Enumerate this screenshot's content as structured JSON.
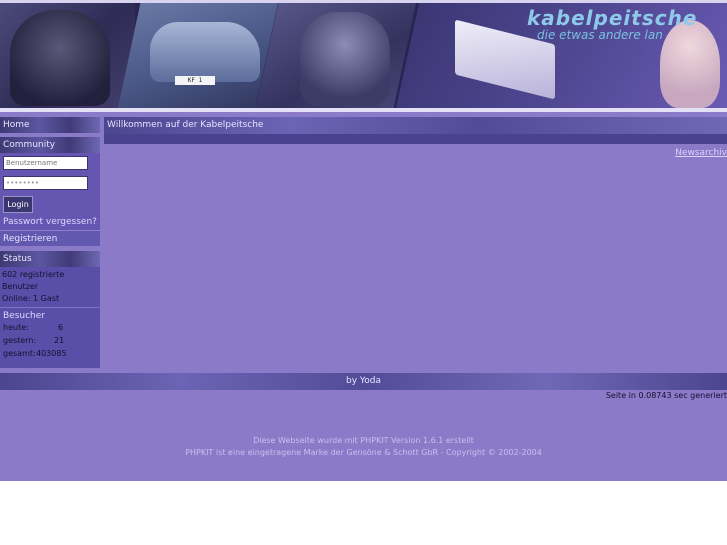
{
  "banner": {
    "logo_text": "kabelpeitsche",
    "slogan": "die etwas andere lan",
    "plate_text": "KF 1"
  },
  "sidebar": {
    "home_label": "Home",
    "community_label": "Community",
    "username_placeholder": "Benutzername",
    "password_value": "••••••••",
    "login_button": "Login",
    "forgot_password": "Passwort vergessen?",
    "register_label": "Registrieren",
    "status_label": "Status",
    "registered_users": "602 registrierte Benutzer",
    "online_text": "Online: 1 Gast",
    "visitors_label": "Besucher",
    "visitors": [
      {
        "label": "heute:",
        "value": "6"
      },
      {
        "label": "gestern:",
        "value": "21"
      },
      {
        "label": "gesamt:",
        "value": "403085"
      }
    ]
  },
  "main": {
    "welcome_title": "Willkommen auf der Kabelpeitsche",
    "newsarchiv_link": "Newsarchiv"
  },
  "footer": {
    "by_text": "by Yoda",
    "generation_time": "Seite in 0.08743 sec generiert",
    "copyright_line1": "Diese Webseite wurde mit PHPKIT Version 1.6.1 erstellt",
    "copyright_line2": "PHPKIT ist eine eingetragene Marke der Gensöne & Schott GbR - Copyright © 2002-2004"
  },
  "colors": {
    "page_background": "#8a7ac8",
    "sidebar_background": "#5b4ea8",
    "header_bar": "#5c56a0"
  }
}
